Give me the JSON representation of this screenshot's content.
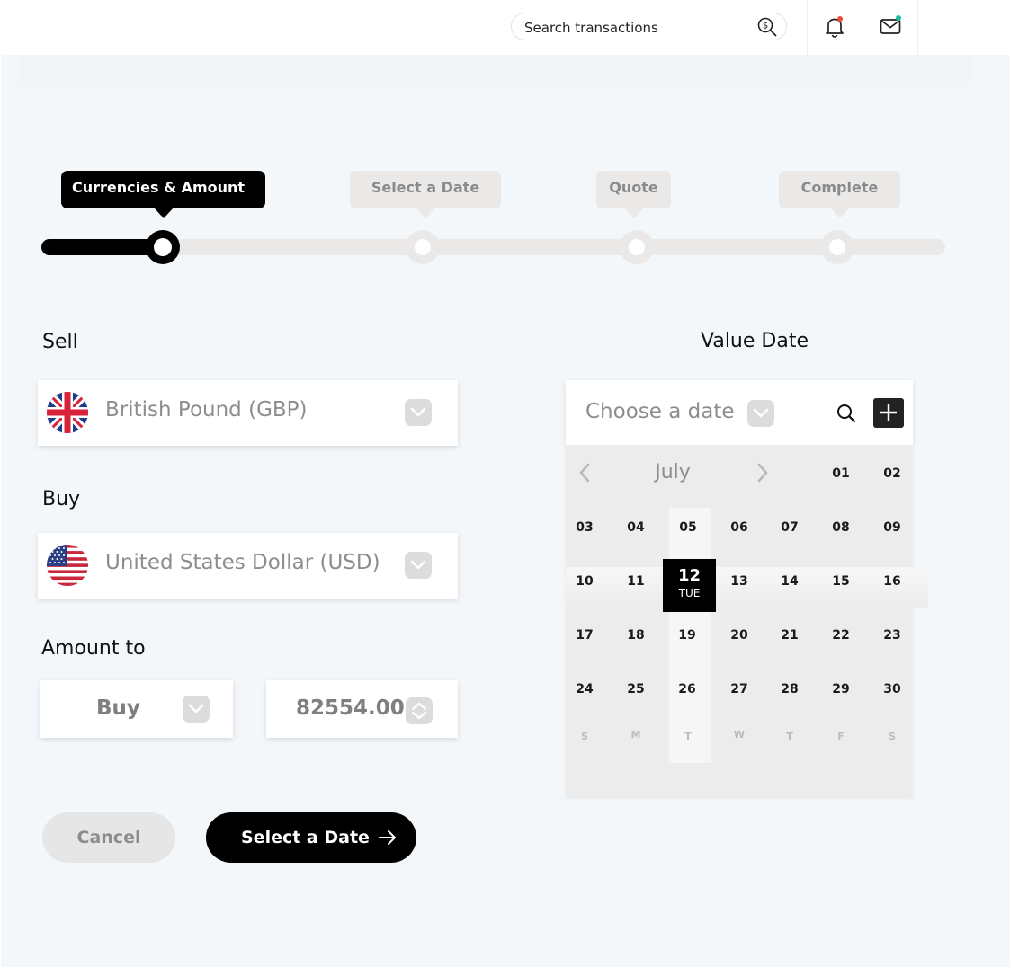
{
  "search": {
    "placeholder": "Search transactions"
  },
  "colors": {
    "accent": "#000000",
    "notification_dot": "#e74c3c",
    "mail_dot": "#1abc9c"
  },
  "icons": {
    "search": "money-search-icon",
    "notifications": "bell-icon",
    "messages": "mail-icon"
  },
  "stepper": {
    "progress": 0.13,
    "steps": [
      {
        "label": "Currencies & Amount",
        "active": true
      },
      {
        "label": "Select a Date",
        "active": false
      },
      {
        "label": "Quote",
        "active": false
      },
      {
        "label": "Complete",
        "active": false
      }
    ]
  },
  "form": {
    "sell_label": "Sell",
    "sell_currency": "British Pound (GBP)",
    "buy_label": "Buy",
    "buy_currency": "United States Dollar (USD)",
    "amount_label": "Amount to",
    "amount_mode": "Buy",
    "amount_value": "82554.00",
    "cancel_label": "Cancel",
    "next_label": "Select a Date"
  },
  "value_date": {
    "label": "Value Date",
    "placeholder": "Choose a date",
    "calendar": {
      "month": "July",
      "selected_day": "12",
      "selected_weekday": "TUE",
      "days": [
        "01",
        "02",
        "03",
        "04",
        "05",
        "06",
        "07",
        "08",
        "09",
        "10",
        "11",
        "13",
        "14",
        "15",
        "16",
        "17",
        "18",
        "19",
        "20",
        "21",
        "22",
        "23",
        "24",
        "25",
        "26",
        "27",
        "28",
        "29",
        "30"
      ],
      "weekdays": [
        "S",
        "M",
        "T",
        "W",
        "T",
        "F",
        "S"
      ]
    }
  }
}
